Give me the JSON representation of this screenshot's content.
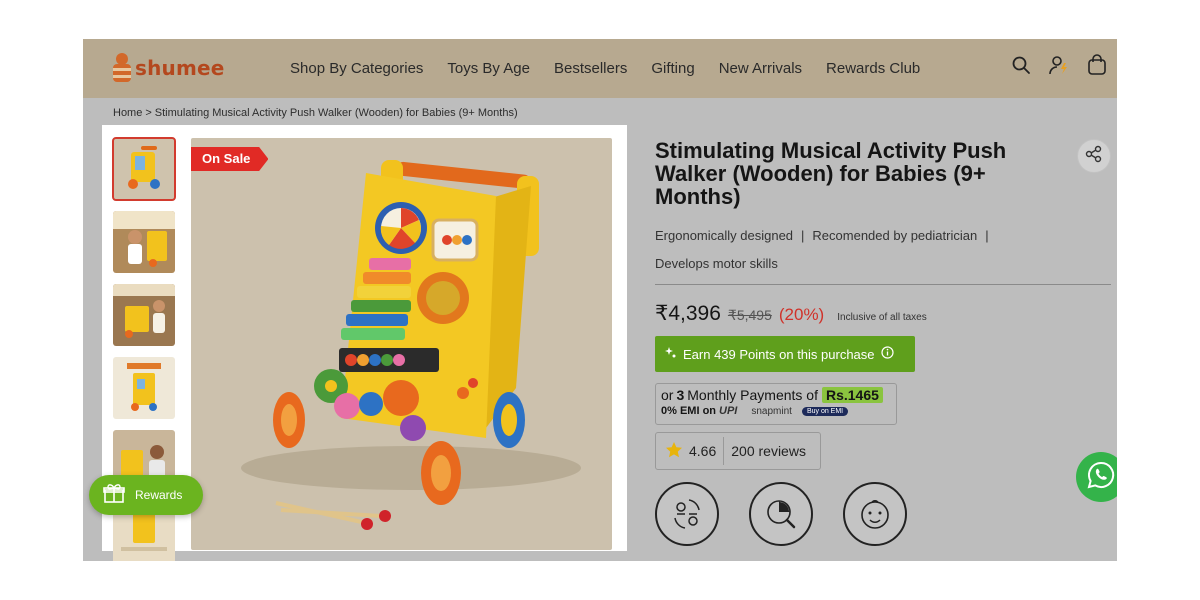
{
  "brand": {
    "name": "shumee"
  },
  "nav": {
    "items": [
      "Shop By Categories",
      "Toys By Age",
      "Bestsellers",
      "Gifting",
      "New Arrivals",
      "Rewards Club"
    ]
  },
  "header_icons": [
    "search-icon",
    "user-icon",
    "cart-icon"
  ],
  "breadcrumb": {
    "home": "Home",
    "separator": ">",
    "current": "Stimulating Musical Activity Push Walker (Wooden) for Babies (9+ Months)"
  },
  "gallery": {
    "sale_badge": "On Sale",
    "thumbnail_count": 6,
    "active_thumbnail": 1
  },
  "rewards_button": {
    "label": "Rewards"
  },
  "product": {
    "title": "Stimulating Musical Activity Push Walker (Wooden) for Babies (9+ Months)",
    "features": [
      "Ergonomically designed",
      "Recomended by pediatrician",
      "Develops motor skills"
    ],
    "feature_separator": "|",
    "price": "₹4,396",
    "mrp": "₹5,495",
    "discount": "(20%)",
    "tax_note": "Inclusive of all taxes",
    "points_text": "Earn 439 Points on this purchase",
    "emi": {
      "prefix": "or",
      "count": "3",
      "suffix": "Monthly Payments of",
      "amount": "Rs.1465",
      "zero_emi": "0% EMI on",
      "upi": "UPI",
      "provider": "snapmint",
      "cta": "Buy on EMI"
    },
    "rating": {
      "score": "4.66",
      "reviews": "200 reviews"
    }
  },
  "colors": {
    "header_bg": "#b7a990",
    "sale_red": "#e12a25",
    "points_green": "#5f9f1c",
    "emi_highlight": "#8ac43f",
    "discount_red": "#d0322a",
    "whatsapp_green": "#34b34a"
  }
}
